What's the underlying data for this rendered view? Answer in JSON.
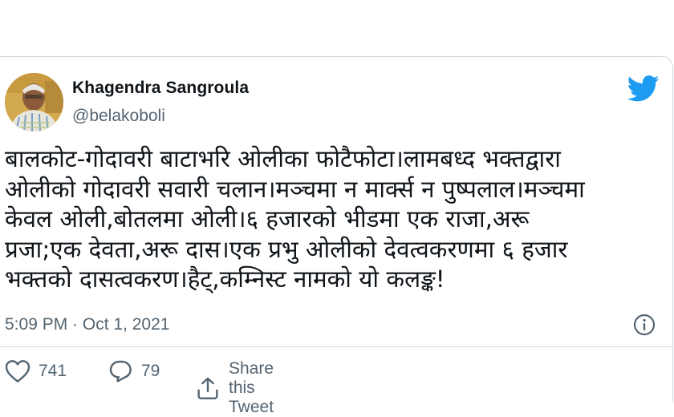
{
  "author": {
    "name": "Khagendra Sangroula",
    "handle": "@belakoboli"
  },
  "tweet": {
    "lines": [
      "बालकोट-गोदावरी बाटाभरि ओलीका फोटैफोटा।लामबध्द भक्तद्वारा",
      "ओलीको गोदावरी सवारी चलान।मञ्चमा न मार्क्स न पुष्पलाल।मञ्चमा",
      "केवल ओली,बोतलमा ओली।६ हजारको भीडमा एक राजा,अरू",
      "प्रजा;एक देवता,अरू दास।एक प्रभु ओलीको देवत्वकरणमा ६ हजार",
      "भक्तको दासत्वकरण।हैट्,कम्निस्ट नामको यो कलङ्क!"
    ],
    "timestamp": "5:09 PM · Oct 1, 2021"
  },
  "actions": {
    "likes": "741",
    "replies": "79",
    "share_label": "Share this Tweet"
  },
  "colors": {
    "twitter_blue": "#1d9bf0",
    "secondary_text": "#536471",
    "border": "#cfd9de"
  },
  "icons": [
    "twitter-bird-icon",
    "info-icon",
    "heart-icon",
    "reply-icon",
    "share-icon"
  ]
}
